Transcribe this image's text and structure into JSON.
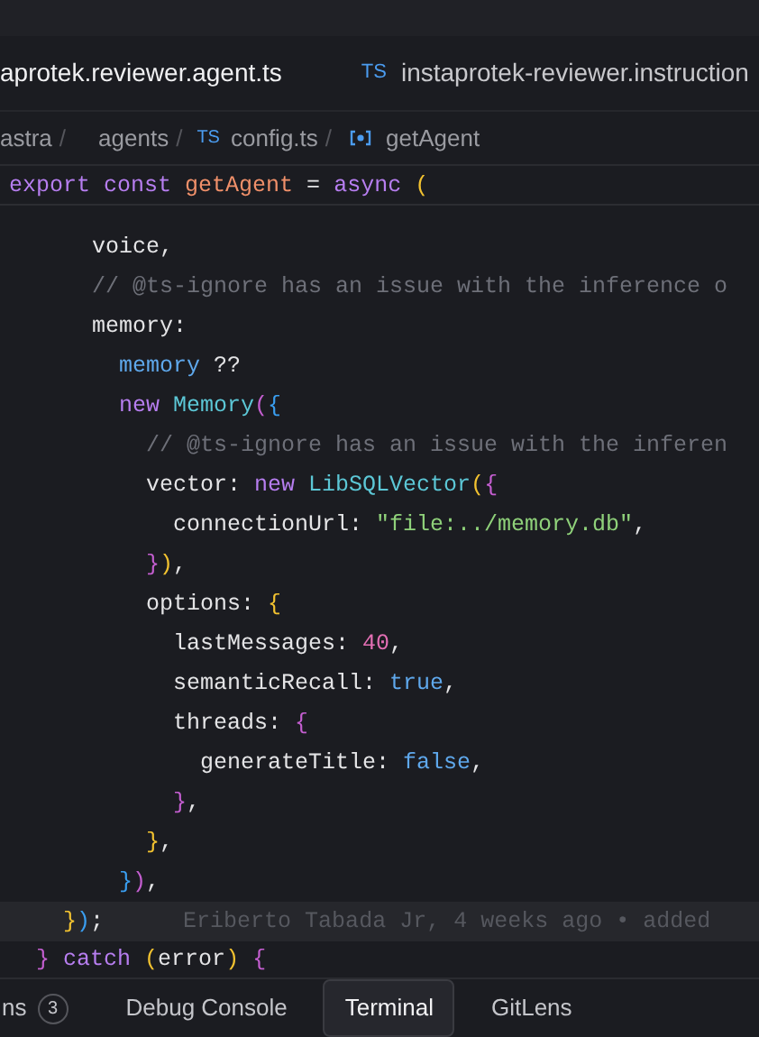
{
  "tabs": [
    {
      "label": "aprotek.reviewer.agent.ts",
      "selected": true
    },
    {
      "icon": "TS",
      "label": "instaprotek-reviewer.instruction",
      "selected": false
    }
  ],
  "breadcrumb": [
    {
      "kind": "folder",
      "label": "astra",
      "separator": "/"
    },
    {
      "kind": "folder",
      "label": "agents",
      "separator": "/"
    },
    {
      "kind": "file",
      "icon": "TS",
      "label": "config.ts",
      "separator": "/"
    },
    {
      "kind": "symbol",
      "label": "getAgent"
    }
  ],
  "sticky_line": [
    {
      "t": "export const ",
      "kind": "kw"
    },
    {
      "t": "getAgent",
      "kind": "fn"
    },
    {
      "t": " = ",
      "kind": "plain"
    },
    {
      "t": "async",
      "kind": "kw"
    },
    {
      "t": " (",
      "kind": "yellow"
    }
  ],
  "code_lines": [
    {
      "tokens": [
        {
          "t": "voice,",
          "kind": "plain"
        }
      ]
    },
    {
      "tokens": [
        {
          "t": "// @ts-ignore has an issue with the inference o",
          "kind": "comment"
        }
      ]
    },
    {
      "tokens": [
        {
          "t": "memory:",
          "kind": "plain"
        }
      ]
    },
    {
      "tokens": [
        {
          "t": "  memory",
          "kind": "var"
        },
        {
          "t": " ??",
          "kind": "plain"
        }
      ]
    },
    {
      "tokens": [
        {
          "t": "  new ",
          "kind": "kw"
        },
        {
          "t": "Memory",
          "kind": "cls"
        },
        {
          "t": "(",
          "kind": "pink"
        },
        {
          "t": "{",
          "kind": "blue"
        }
      ]
    },
    {
      "tokens": [
        {
          "t": "    // @ts-ignore has an issue with the inferen",
          "kind": "comment"
        }
      ]
    },
    {
      "tokens": [
        {
          "t": "    vector: ",
          "kind": "plain"
        },
        {
          "t": "new ",
          "kind": "kw"
        },
        {
          "t": "LibSQLVector",
          "kind": "cls"
        },
        {
          "t": "(",
          "kind": "yellow"
        },
        {
          "t": "{",
          "kind": "pink"
        }
      ]
    },
    {
      "tokens": [
        {
          "t": "      connectionUrl: ",
          "kind": "plain"
        },
        {
          "t": "\"file:../memory.db\"",
          "kind": "str"
        },
        {
          "t": ",",
          "kind": "plain"
        }
      ]
    },
    {
      "tokens": [
        {
          "t": "    }",
          "kind": "pink"
        },
        {
          "t": ")",
          "kind": "yellow"
        },
        {
          "t": ",",
          "kind": "plain"
        }
      ]
    },
    {
      "tokens": [
        {
          "t": "    options: ",
          "kind": "plain"
        },
        {
          "t": "{",
          "kind": "yellow"
        }
      ]
    },
    {
      "tokens": [
        {
          "t": "      lastMessages: ",
          "kind": "plain"
        },
        {
          "t": "40",
          "kind": "num"
        },
        {
          "t": ",",
          "kind": "plain"
        }
      ]
    },
    {
      "tokens": [
        {
          "t": "      semanticRecall: ",
          "kind": "plain"
        },
        {
          "t": "true",
          "kind": "var"
        },
        {
          "t": ",",
          "kind": "plain"
        }
      ]
    },
    {
      "tokens": [
        {
          "t": "      threads: ",
          "kind": "plain"
        },
        {
          "t": "{",
          "kind": "pink"
        }
      ]
    },
    {
      "tokens": [
        {
          "t": "        generateTitle: ",
          "kind": "plain"
        },
        {
          "t": "false",
          "kind": "var"
        },
        {
          "t": ",",
          "kind": "plain"
        }
      ]
    },
    {
      "tokens": [
        {
          "t": "      }",
          "kind": "pink"
        },
        {
          "t": ",",
          "kind": "plain"
        }
      ]
    },
    {
      "tokens": [
        {
          "t": "    }",
          "kind": "yellow"
        },
        {
          "t": ",",
          "kind": "plain"
        }
      ]
    },
    {
      "tokens": [
        {
          "t": "  }",
          "kind": "blue"
        },
        {
          "t": ")",
          "kind": "pink"
        },
        {
          "t": ",",
          "kind": "plain"
        }
      ]
    },
    {
      "tokens": [
        {
          "t": "}",
          "kind": "yellow"
        },
        {
          "t": ")",
          "kind": "blue"
        },
        {
          "t": ";",
          "kind": "plain"
        }
      ],
      "current": true,
      "blame": "Eriberto Tabada Jr, 4 weeks ago • added"
    }
  ],
  "last_line": [
    {
      "t": "}",
      "kind": "pink"
    },
    {
      "t": " catch ",
      "kind": "kw"
    },
    {
      "t": "(",
      "kind": "yellow"
    },
    {
      "t": "error",
      "kind": "plain"
    },
    {
      "t": ")",
      "kind": "yellow"
    },
    {
      "t": " {",
      "kind": "pink"
    }
  ],
  "panel_tabs": [
    {
      "label": "ns",
      "badge": "3",
      "selected": false
    },
    {
      "label": "Debug Console",
      "selected": false
    },
    {
      "label": "Terminal",
      "selected": true
    },
    {
      "label": "GitLens",
      "selected": false
    }
  ]
}
